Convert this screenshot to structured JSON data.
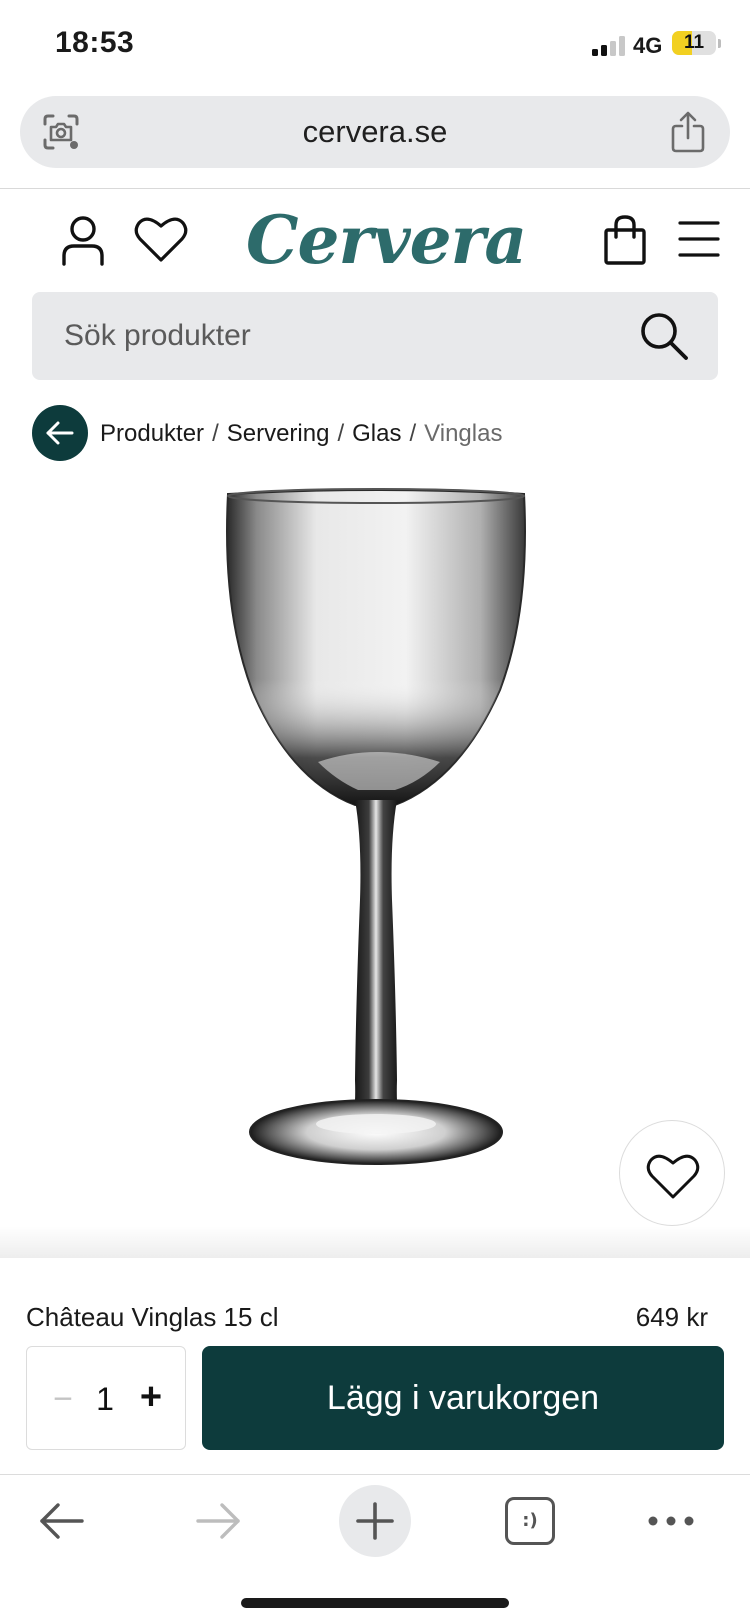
{
  "status_bar": {
    "time": "18:53",
    "network": "4G",
    "battery": "11",
    "battery_level": 0.11
  },
  "browser": {
    "url": "cervera.se"
  },
  "header": {
    "logo_text": "Cervera"
  },
  "search": {
    "placeholder": "Sök produkter"
  },
  "breadcrumb": {
    "items": [
      "Produkter",
      "Servering",
      "Glas"
    ],
    "current": "Vinglas",
    "separator": "/"
  },
  "product": {
    "name": "Château Vinglas 15 cl",
    "price": "649 kr",
    "quantity": "1",
    "qty_minus": "−",
    "qty_plus": "+",
    "add_to_cart_label": "Lägg i varukorgen"
  },
  "toolbar": {
    "tabs_label": ":)"
  },
  "colors": {
    "brand_teal": "#2d6b6b",
    "button_dark": "#0d3b3c",
    "battery_yellow": "#f2d021"
  },
  "icons": {
    "account": "account-icon",
    "wishlist": "heart-icon",
    "bag": "shopping-bag-icon",
    "menu": "hamburger-menu-icon",
    "search": "search-icon",
    "back": "arrow-left-icon",
    "share": "share-icon",
    "lens": "camera-search-icon"
  }
}
